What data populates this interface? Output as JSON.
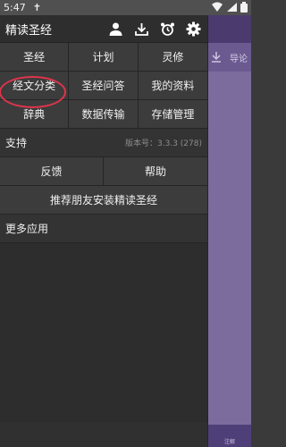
{
  "status_bar": {
    "time": "5:47",
    "extra_icon": "✝"
  },
  "background_app": {
    "tab_label": "导论",
    "footer_label": "注解"
  },
  "drawer": {
    "title": "精读圣经",
    "header_icons": [
      "person-icon",
      "download-icon",
      "alarm-clock-icon",
      "gear-icon"
    ],
    "main_grid": [
      "圣经",
      "计划",
      "灵修",
      "经文分类",
      "圣经问答",
      "我的资料",
      "辞典",
      "数据传输",
      "存储管理"
    ],
    "support": {
      "title": "支持",
      "version": "版本号：3.3.3 (278)",
      "buttons": [
        "反馈",
        "帮助"
      ],
      "recommend": "推荐朋友安装精读圣经"
    },
    "more_apps": "更多应用"
  },
  "colors": {
    "highlight": "#e0344b",
    "drawer_bg": "#303030",
    "background_app": "#5d4d83"
  }
}
